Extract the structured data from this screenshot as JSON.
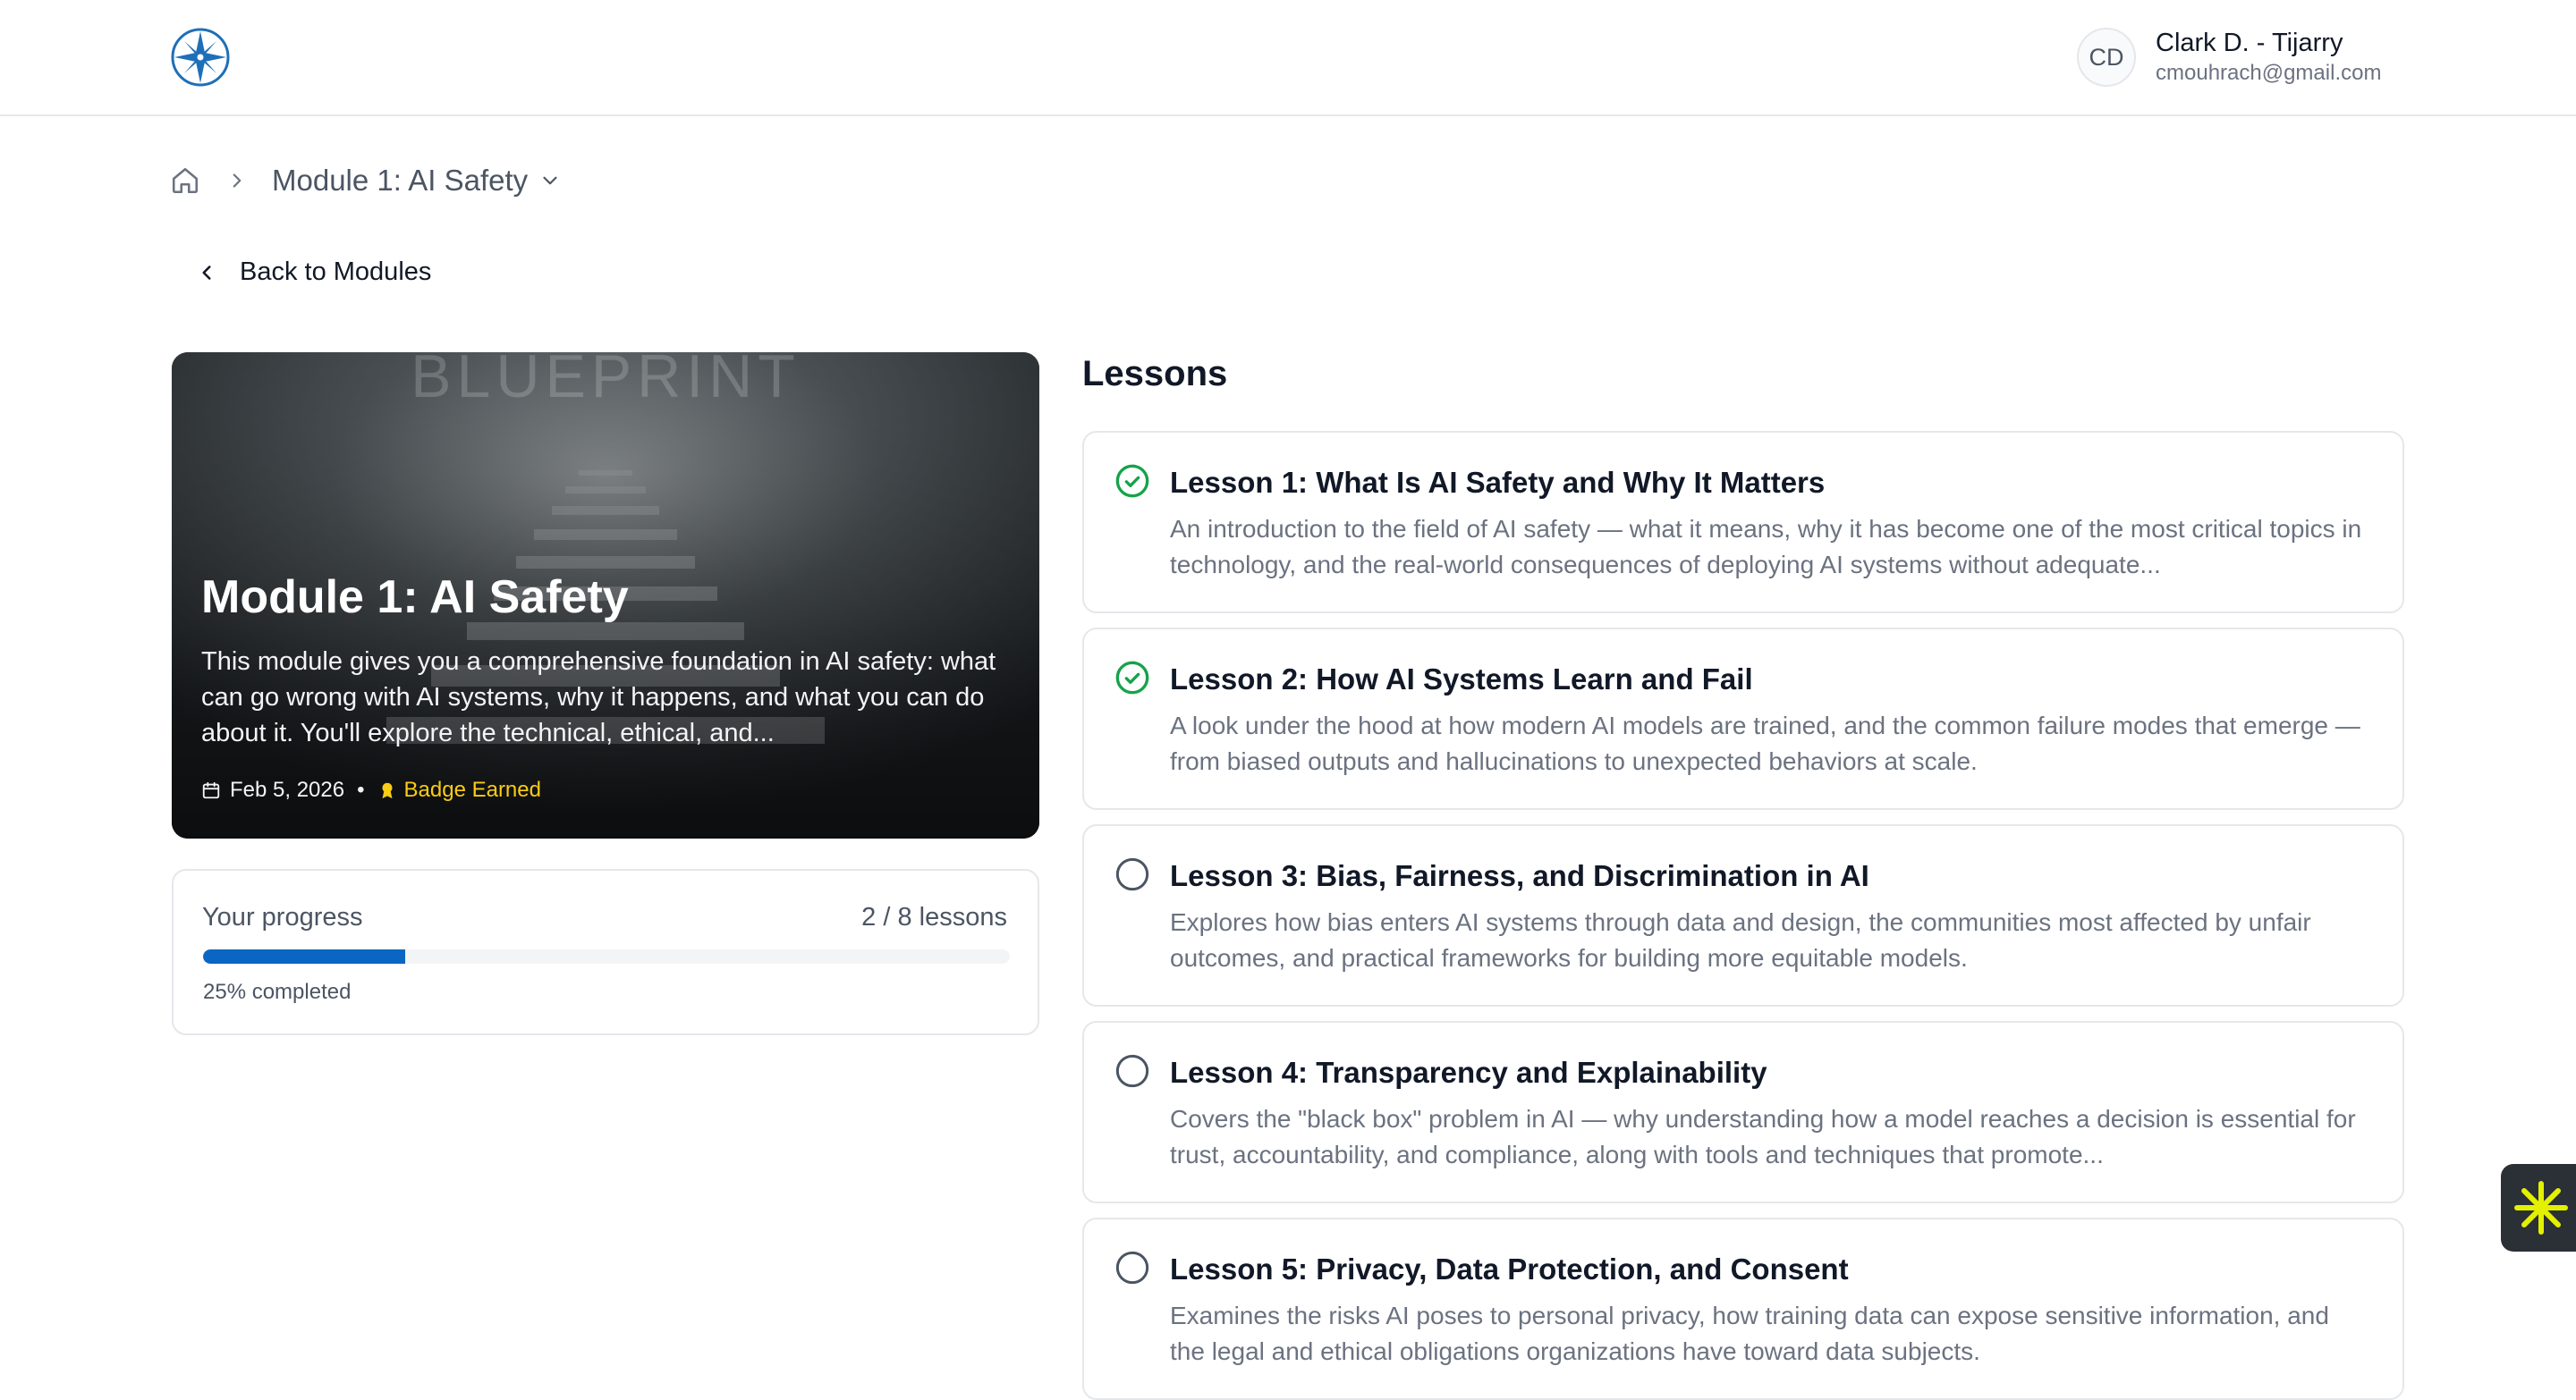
{
  "user": {
    "initials": "CD",
    "name": "Clark D. - Tijarry",
    "email": "cmouhrach@gmail.com"
  },
  "breadcrumb": {
    "current": "Module 1: AI Safety"
  },
  "back_label": "Back to Modules",
  "module": {
    "title": "Module 1: AI Safety",
    "description": "This module gives you a comprehensive foundation in AI safety: what can go wrong with AI systems, why it happens, and what you can do about it. You'll explore the technical, ethical, and...",
    "date": "Feb 5, 2026",
    "separator": "•",
    "badge": "Badge Earned",
    "background_text": "BLUEPRINT"
  },
  "progress": {
    "label": "Your progress",
    "count": "2 / 8 lessons",
    "percent_text": "25% completed",
    "fraction": 0.25
  },
  "lessons_title": "Lessons",
  "lessons": [
    {
      "title": "Lesson 1: What Is AI Safety and Why It Matters",
      "description": "An introduction to the field of AI safety — what it means, why it has become one of the most critical topics in technology, and the real-world consequences of deploying AI systems without adequate...",
      "completed": true
    },
    {
      "title": "Lesson 2: How AI Systems Learn and Fail",
      "description": "A look under the hood at how modern AI models are trained, and the common failure modes that emerge — from biased outputs and hallucinations to unexpected behaviors at scale.",
      "completed": true
    },
    {
      "title": "Lesson 3: Bias, Fairness, and Discrimination in AI",
      "description": "Explores how bias enters AI systems through data and design, the communities most affected by unfair outcomes, and practical frameworks for building more equitable models.",
      "completed": false
    },
    {
      "title": "Lesson 4: Transparency and Explainability",
      "description": "Covers the \"black box\" problem in AI — why understanding how a model reaches a decision is essential for trust, accountability, and compliance, along with tools and techniques that promote...",
      "completed": false
    },
    {
      "title": "Lesson 5: Privacy, Data Protection, and Consent",
      "description": "Examines the risks AI poses to personal privacy, how training data can expose sensitive information, and the legal and ethical obligations organizations have toward data subjects.",
      "completed": false
    }
  ],
  "colors": {
    "accent": "#0a66c2",
    "success": "#16a34a",
    "badge": "#facc15",
    "widget_star": "#e3f000"
  },
  "icons": {
    "logo": "compass-logo-icon",
    "home": "home-icon",
    "breadcrumb_separator": "chevron-right-icon",
    "breadcrumb_dropdown": "chevron-down-icon",
    "back": "chevron-left-icon",
    "date": "calendar-icon",
    "badge": "award-icon",
    "completed": "check-circle-icon",
    "pending": "empty-circle-icon",
    "widget": "sparkle-icon"
  }
}
